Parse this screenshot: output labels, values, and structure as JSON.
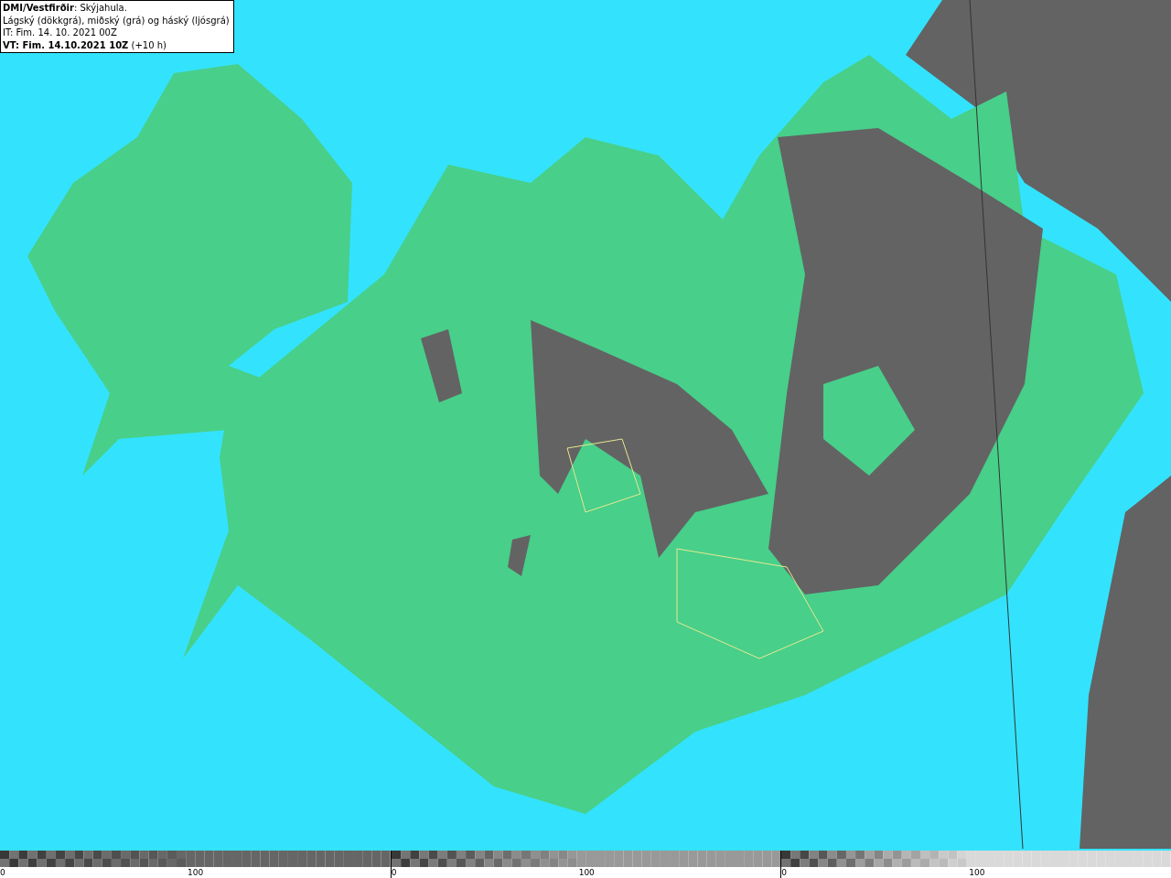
{
  "info_box": {
    "lines": [
      "**DMI/Vestfirðir**: Skýjahula.",
      "Lágský (dökkgrá), miðský (grá) og háský (ljósgrá)",
      "IT: Fim. 14. 10. 2021 00Z",
      "**VT: Fim. 14.10.2021 10Z** (+10 h)"
    ]
  },
  "legend": [
    {
      "kind": "low",
      "min": "0",
      "mid": "100"
    },
    {
      "kind": "mid",
      "min": "0",
      "mid": "100"
    },
    {
      "kind": "high",
      "min": "0",
      "mid": "100"
    }
  ]
}
